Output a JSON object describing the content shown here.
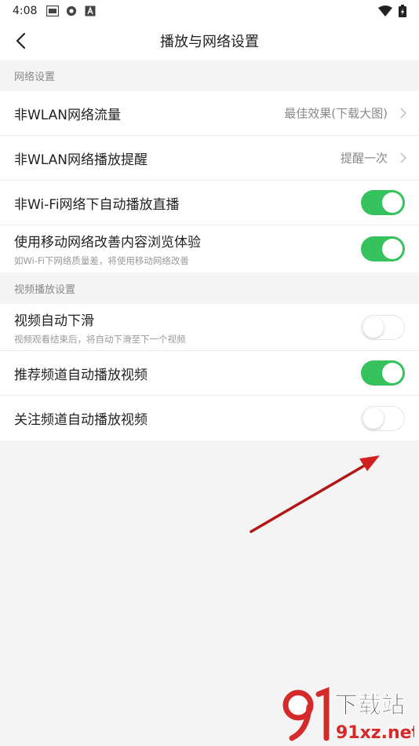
{
  "status_bar": {
    "time": "4:08"
  },
  "header": {
    "title": "播放与网络设置"
  },
  "sections": [
    {
      "title": "网络设置",
      "rows": [
        {
          "title": "非WLAN网络流量",
          "value": "最佳效果(下载大图)"
        },
        {
          "title": "非WLAN网络播放提醒",
          "value": "提醒一次"
        },
        {
          "title": "非Wi-Fi网络下自动播放直播",
          "toggle": true
        },
        {
          "title": "使用移动网络改善内容浏览体验",
          "subtitle": "如Wi-Fi下网络质量差，将使用移动网络改善",
          "toggle": true
        }
      ]
    },
    {
      "title": "视频播放设置",
      "rows": [
        {
          "title": "视频自动下滑",
          "subtitle": "视频观看结束后，将自动下滑至下一个视频",
          "toggle": false
        },
        {
          "title": "推荐频道自动播放视频",
          "toggle": true
        },
        {
          "title": "关注频道自动播放视频",
          "toggle": false
        }
      ]
    }
  ],
  "colors": {
    "toggle_on": "#36c25c",
    "annotation_arrow": "#e02020"
  },
  "watermark": {
    "text": "下载站",
    "site": "91xz.net"
  }
}
